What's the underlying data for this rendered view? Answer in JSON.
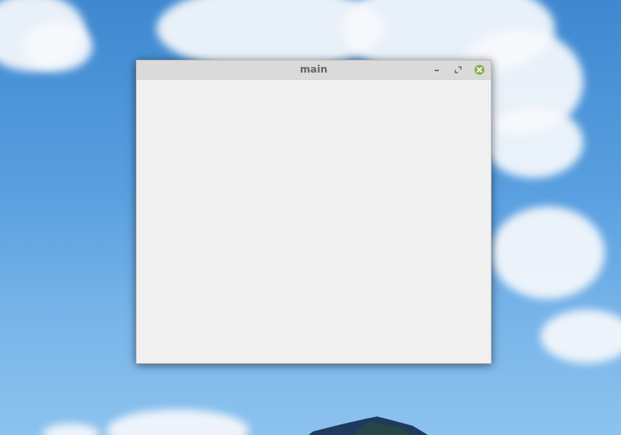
{
  "window": {
    "title": "main"
  },
  "controls": {
    "minimize_icon": "minimize-icon",
    "maximize_icon": "maximize-icon",
    "close_icon": "close-icon",
    "close_color": "#8bb158"
  },
  "colors": {
    "titlebar": "#dadada",
    "client": "#f0f0f0",
    "sky": "#5aa0e0"
  }
}
